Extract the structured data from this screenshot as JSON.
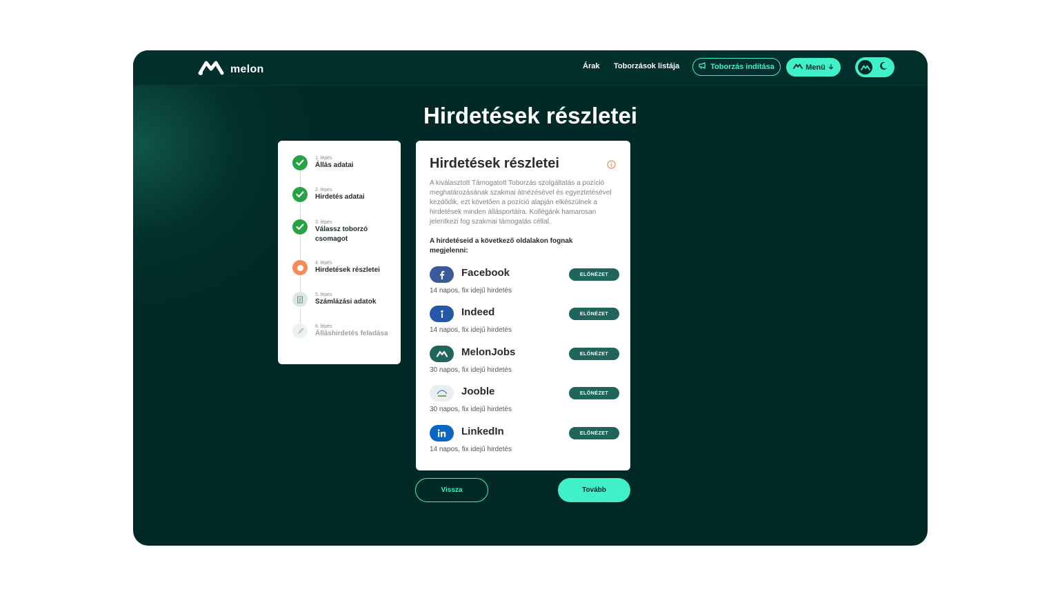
{
  "brand": {
    "name": "melon"
  },
  "nav": {
    "links": [
      "Árak",
      "Toborzások listája"
    ],
    "start_button": "Toborzás indítása",
    "menu_button": "Menü"
  },
  "page": {
    "title": "Hirdetések részletei"
  },
  "steps": [
    {
      "number": "1. lépés",
      "name": "Állás adatai",
      "status": "done"
    },
    {
      "number": "2. lépés",
      "name": "Hirdetés adatai",
      "status": "done"
    },
    {
      "number": "3. lépés",
      "name": "Válassz toborzó csomagot",
      "status": "done"
    },
    {
      "number": "4. lépés",
      "name": "Hirdetések részletei",
      "status": "current"
    },
    {
      "number": "5. lépés",
      "name": "Számlázási adatok",
      "status": "pending"
    },
    {
      "number": "6. lépés",
      "name": "Álláshirdetés feladása",
      "status": "disabled"
    }
  ],
  "card": {
    "title": "Hirdetések részletei",
    "description": "A kiválasztott Támogatott Toborzás szolgáltatás a pozíció meghatározásának szakmai átnézésével és egyeztetésével kezdődik, ezt követően a pozíció alapján elkészülnek a hirdetések minden állásportálra. Kollégánk hamarosan jelentkezi fog szakmai támogatás céllal.",
    "notice": "A hirdetéseid a következő oldalakon fognak megjelenni:",
    "preview_label": "ELŐNÉZET",
    "portals": [
      {
        "name": "Facebook",
        "duration": "14 napos, fix idejű hirdetés",
        "icon": "facebook-icon",
        "color": "#3b5a9a"
      },
      {
        "name": "Indeed",
        "duration": "14 napos, fix idejű hirdetés",
        "icon": "indeed-icon",
        "color": "#2557a7"
      },
      {
        "name": "MelonJobs",
        "duration": "30 napos, fix idejű hirdetés",
        "icon": "melon-icon",
        "color": "#20655b"
      },
      {
        "name": "Jooble",
        "duration": "30 napos, fix idejű hirdetés",
        "icon": "jooble-icon",
        "color": "#e9eef2"
      },
      {
        "name": "LinkedIn",
        "duration": "14 napos, fix idejű hirdetés",
        "icon": "linkedin-icon",
        "color": "#0a66c2"
      }
    ]
  },
  "actions": {
    "back": "Vissza",
    "next": "Tovább"
  },
  "colors": {
    "background": "#012a27",
    "accent": "#3ff0c9",
    "done": "#27a343",
    "current": "#f58b55"
  }
}
